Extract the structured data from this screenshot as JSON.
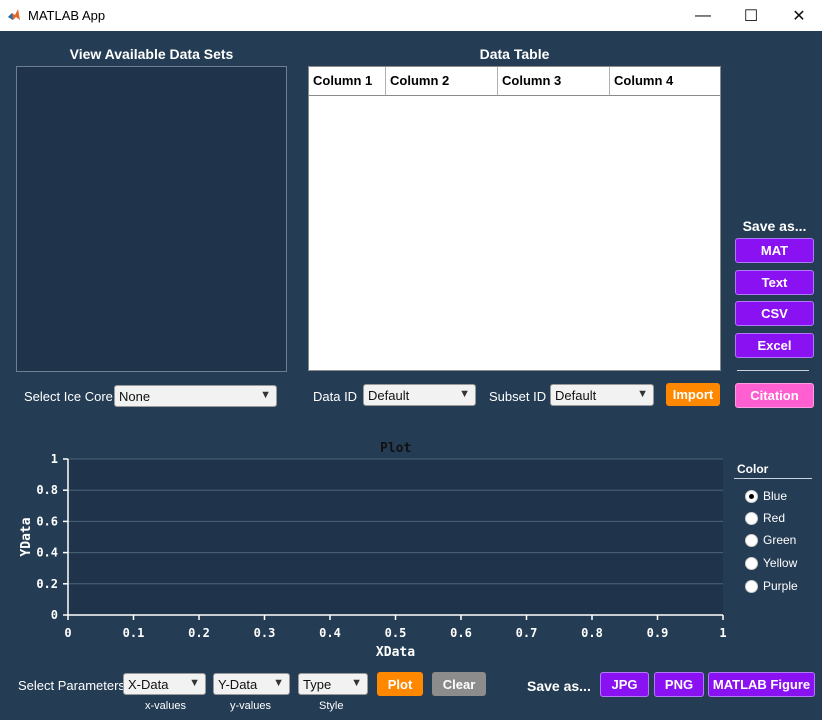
{
  "window": {
    "title": "MATLAB App",
    "controls": {
      "minimize": "—",
      "maximize": "☐",
      "close": "✕"
    }
  },
  "datasets_panel": {
    "heading": "View Available Data Sets"
  },
  "data_table": {
    "heading": "Data Table",
    "columns": [
      "Column 1",
      "Column 2",
      "Column 3",
      "Column 4"
    ]
  },
  "save_panel": {
    "heading": "Save as...",
    "buttons": {
      "mat": "MAT",
      "text": "Text",
      "csv": "CSV",
      "excel": "Excel"
    },
    "citation": "Citation"
  },
  "ice_core": {
    "label": "Select Ice Core",
    "value": "None"
  },
  "data_id": {
    "label": "Data ID",
    "value": "Default"
  },
  "subset_id": {
    "label": "Subset ID",
    "value": "Default"
  },
  "import_button": "Import",
  "plot": {
    "title": "Plot",
    "xlabel": "XData",
    "ylabel": "YData",
    "x_ticks": [
      "0",
      "0.1",
      "0.2",
      "0.3",
      "0.4",
      "0.5",
      "0.6",
      "0.7",
      "0.8",
      "0.9",
      "1"
    ],
    "y_ticks": [
      "0",
      "0.2",
      "0.4",
      "0.6",
      "0.8",
      "1"
    ]
  },
  "color_panel": {
    "heading": "Color",
    "options": [
      "Blue",
      "Red",
      "Green",
      "Yellow",
      "Purple"
    ],
    "selected": "Blue"
  },
  "parameters": {
    "label": "Select Parameters",
    "x_select": "X-Data",
    "y_select": "Y-Data",
    "type_select": "Type",
    "x_caption": "x-values",
    "y_caption": "y-values",
    "type_caption": "Style",
    "plot_button": "Plot",
    "clear_button": "Clear"
  },
  "figure_save": {
    "label": "Save as...",
    "jpg": "JPG",
    "png": "PNG",
    "matlab_figure": "MATLAB Figure"
  },
  "colors": {
    "background": "#253d54",
    "panel": "#1f344b",
    "purple": "#8a12f2",
    "orange": "#ff8800",
    "pink": "#ff5fd0",
    "gray": "#8c8c8c"
  }
}
